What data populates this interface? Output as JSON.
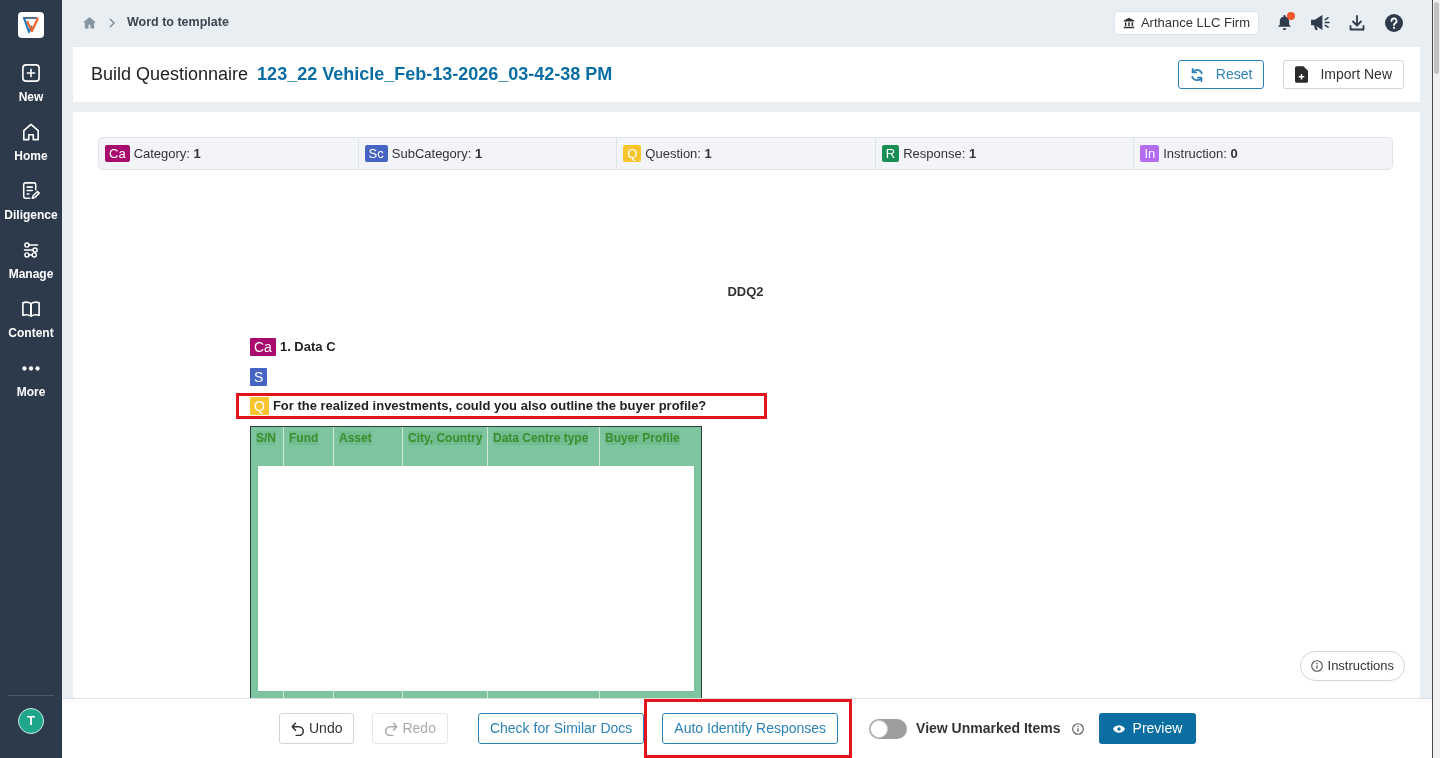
{
  "sidebar": {
    "items": [
      {
        "label": "New"
      },
      {
        "label": "Home"
      },
      {
        "label": "Diligence"
      },
      {
        "label": "Manage"
      },
      {
        "label": "Content"
      },
      {
        "label": "More"
      }
    ],
    "avatar": "T"
  },
  "topbar": {
    "breadcrumb": [
      "Word to template"
    ],
    "firm": "Arthance LLC Firm",
    "unread_notifications": true
  },
  "header": {
    "label": "Build Questionnaire",
    "name": "123_22 Vehicle_Feb-13-2026_03-42-38 PM",
    "actions": [
      {
        "label": "Reset",
        "kind": "reset"
      },
      {
        "label": "Import New",
        "kind": "import"
      }
    ]
  },
  "counts": [
    {
      "badge": "Ca",
      "color": "#a90a6d",
      "label": "Category:",
      "value": "1"
    },
    {
      "badge": "Sc",
      "color": "#4564c3",
      "label": "SubCategory:",
      "value": "1"
    },
    {
      "badge": "Q",
      "color": "#f9c52f",
      "label": "Question:",
      "value": "1"
    },
    {
      "badge": "R",
      "color": "#1a8f55",
      "label": "Response:",
      "value": "1"
    },
    {
      "badge": "In",
      "color": "#b36bf2",
      "label": "Instruction:",
      "value": "0"
    }
  ],
  "document": {
    "title": "DDQ2",
    "blocks": [
      {
        "badge": "Ca",
        "color": "#a90a6d",
        "text": "1. Data C",
        "highlighted": false
      },
      {
        "badge": "S",
        "color": "#4564c3",
        "highlighted": false
      },
      {
        "badge": "Q",
        "color": "#f9c52f",
        "text": "For the realized investments, could you also outline the buyer profile?",
        "highlighted": true
      }
    ],
    "table": {
      "columns": [
        "S/N",
        "Fund",
        "Asset",
        "City, Country",
        "Data Centre type",
        "Buyer Profile"
      ]
    }
  },
  "instructions": "Instructions",
  "footer": {
    "buttons": [
      {
        "label": "Undo",
        "kind": "undo",
        "disabled": false,
        "highlighted": false
      },
      {
        "label": "Redo",
        "kind": "redo",
        "disabled": true,
        "highlighted": false
      },
      {
        "label": "Check for Similar Docs",
        "kind": "outline",
        "disabled": false,
        "highlighted": false
      },
      {
        "label": "Auto Identify Responses",
        "kind": "outline",
        "disabled": false,
        "highlighted": true
      }
    ],
    "toggle": {
      "label": "View Unmarked Items",
      "on": false
    },
    "preview": {
      "label": "Preview"
    }
  }
}
